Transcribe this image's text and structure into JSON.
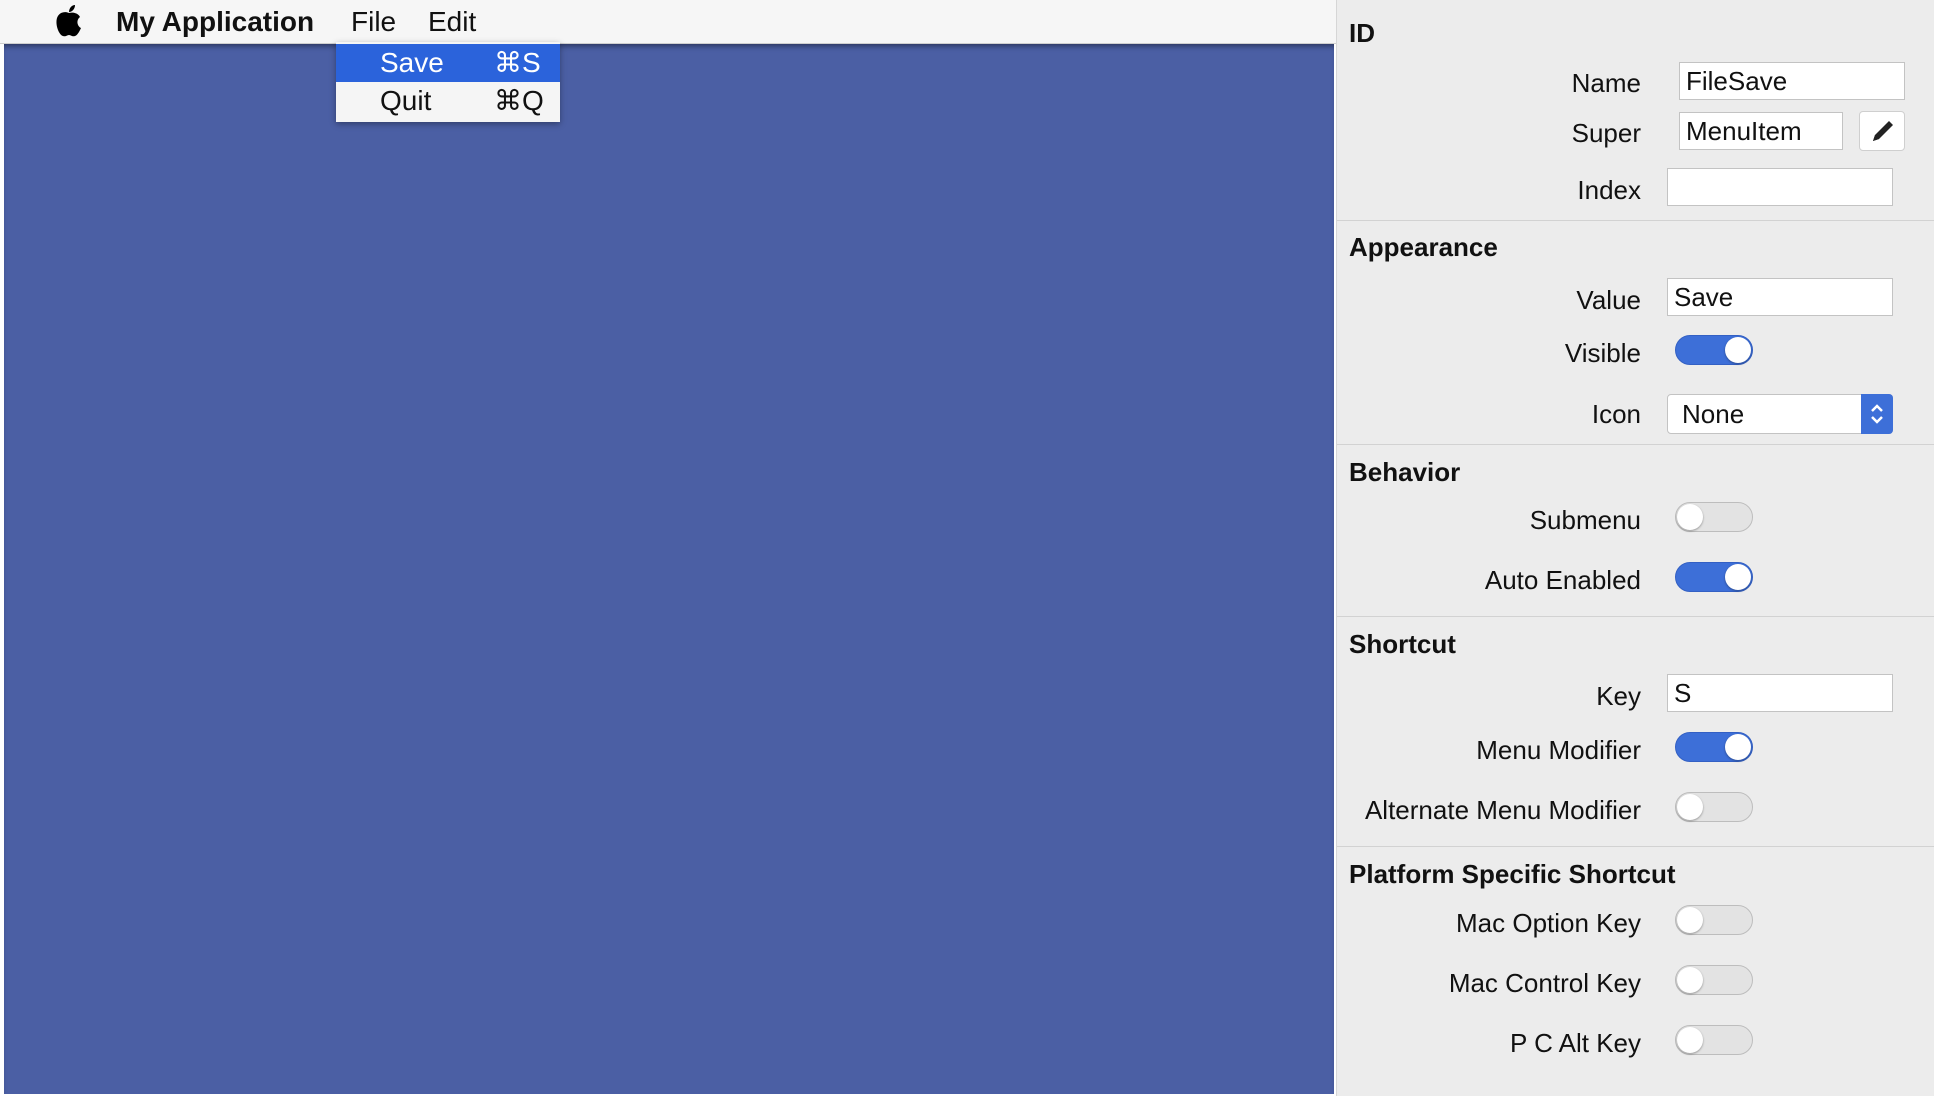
{
  "menubar": {
    "app_name": "My Application",
    "menus": [
      "File",
      "Edit"
    ]
  },
  "dropdown": {
    "items": [
      {
        "label": "Save",
        "shortcut": "⌘S",
        "highlighted": true
      },
      {
        "label": "Quit",
        "shortcut": "⌘Q",
        "highlighted": false
      }
    ]
  },
  "canvas": {
    "background_color": "#4b5fa4"
  },
  "inspector": {
    "id": {
      "title": "ID",
      "name_label": "Name",
      "name_value": "FileSave",
      "super_label": "Super",
      "super_value": "MenuItem",
      "index_label": "Index",
      "index_value": ""
    },
    "appearance": {
      "title": "Appearance",
      "value_label": "Value",
      "value_value": "Save",
      "visible_label": "Visible",
      "visible_on": true,
      "icon_label": "Icon",
      "icon_value": "None"
    },
    "behavior": {
      "title": "Behavior",
      "submenu_label": "Submenu",
      "submenu_on": false,
      "auto_enabled_label": "Auto Enabled",
      "auto_enabled_on": true
    },
    "shortcut": {
      "title": "Shortcut",
      "key_label": "Key",
      "key_value": "S",
      "menu_modifier_label": "Menu Modifier",
      "menu_modifier_on": true,
      "alt_menu_modifier_label": "Alternate Menu Modifier",
      "alt_menu_modifier_on": false
    },
    "platform": {
      "title": "Platform Specific Shortcut",
      "mac_option_label": "Mac Option Key",
      "mac_option_on": false,
      "mac_control_label": "Mac Control Key",
      "mac_control_on": false,
      "pc_alt_label": "P C Alt Key",
      "pc_alt_on": false
    }
  },
  "colors": {
    "accent": "#3d6fd8",
    "menu_highlight": "#2b63db"
  },
  "icons": [
    "apple-logo",
    "pencil-icon",
    "select-stepper-icon"
  ]
}
